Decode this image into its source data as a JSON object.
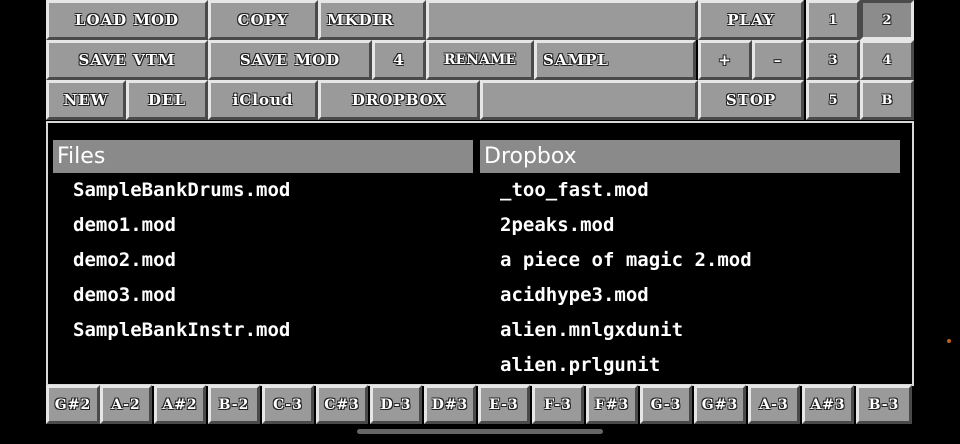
{
  "toolbar": {
    "row1": {
      "load_mod": "LOAD MOD",
      "copy": "COPY",
      "mkdir": "MKDIR",
      "play": "PLAY",
      "one": "1",
      "two": "2"
    },
    "row2": {
      "save_vtm": "SAVE VTM",
      "save_mod": "SAVE MOD",
      "four_num": "4",
      "rename": "RENAME",
      "sampl": "SAMPL",
      "plus": "+",
      "minus": "–",
      "three": "3",
      "four": "4"
    },
    "row3": {
      "new": "NEW",
      "del": "DEL",
      "icloud": "iCloud",
      "dropbox": "DROPBOX",
      "stop": "STOP",
      "five": "5",
      "b": "B"
    }
  },
  "files": {
    "header": "Files",
    "items": [
      "SampleBankDrums.mod",
      "demo1.mod",
      "demo2.mod",
      "demo3.mod",
      "SampleBankInstr.mod"
    ]
  },
  "dropbox": {
    "header": "Dropbox",
    "items": [
      "_too_fast.mod",
      "2peaks.mod",
      "a piece of magic 2.mod",
      "acidhype3.mod",
      "alien.mnlgxdunit",
      "alien.prlgunit"
    ]
  },
  "notes": [
    "G#2",
    "A-2",
    "A#2",
    "B-2",
    "C-3",
    "C#3",
    "D-3",
    "D#3",
    "E-3",
    "F-3",
    "F#3",
    "G-3",
    "G#3",
    "A-3",
    "A#3",
    "B-3"
  ]
}
